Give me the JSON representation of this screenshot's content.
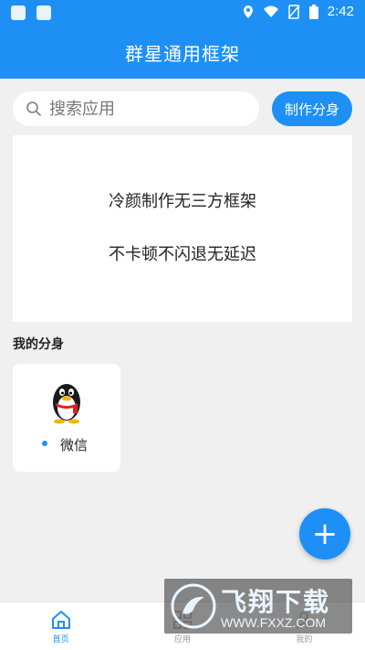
{
  "status_bar": {
    "time": "2:42",
    "icons": [
      "notification-icon",
      "notification-icon-2",
      "location-icon",
      "wifi-icon",
      "no-sim-icon",
      "battery-icon"
    ]
  },
  "app_bar": {
    "title": "群星通用框架"
  },
  "search": {
    "placeholder": "搜索应用"
  },
  "make_clone_button": {
    "label": "制作分身"
  },
  "banner": {
    "line1": "冷颜制作无三方框架",
    "line2": "不卡顿不闪退无延迟"
  },
  "my_clones": {
    "title": "我的分身",
    "items": [
      {
        "name": "微信",
        "icon": "qq-penguin-icon"
      }
    ]
  },
  "fab": {
    "label": "+"
  },
  "bottom_nav": {
    "items": [
      {
        "label": "首页",
        "icon": "home-icon",
        "active": true
      },
      {
        "label": "应用",
        "icon": "apps-icon",
        "active": false
      },
      {
        "label": "我的",
        "icon": "profile-icon",
        "active": false
      }
    ]
  },
  "watermark": {
    "title": "飞翔下载",
    "url": "WWW.FXXZ.COM"
  },
  "colors": {
    "primary": "#1e90f5",
    "background": "#f0f0f0",
    "card": "#ffffff"
  }
}
